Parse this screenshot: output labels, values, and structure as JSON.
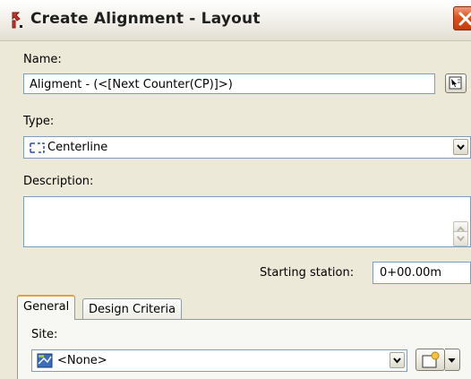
{
  "window": {
    "title": "Create Alignment - Layout"
  },
  "name_field": {
    "label": "Name:",
    "value": "Aligment - (<[Next Counter(CP)]>)"
  },
  "type_field": {
    "label": "Type:",
    "value": "Centerline",
    "icon": "centerline-icon"
  },
  "description_field": {
    "label": "Description:",
    "value": ""
  },
  "starting_station": {
    "label": "Starting station:",
    "value": "0+00.00m"
  },
  "tabs": [
    {
      "label": "General",
      "selected": true
    },
    {
      "label": "Design Criteria",
      "selected": false
    }
  ],
  "site_field": {
    "label": "Site:",
    "value": "<None>",
    "icon": "site-icon"
  },
  "colors": {
    "field_border": "#7f9db9",
    "dialog_bg": "#ece9d8",
    "close_button": "#d9541e",
    "tab_highlight": "#e3a13b"
  }
}
